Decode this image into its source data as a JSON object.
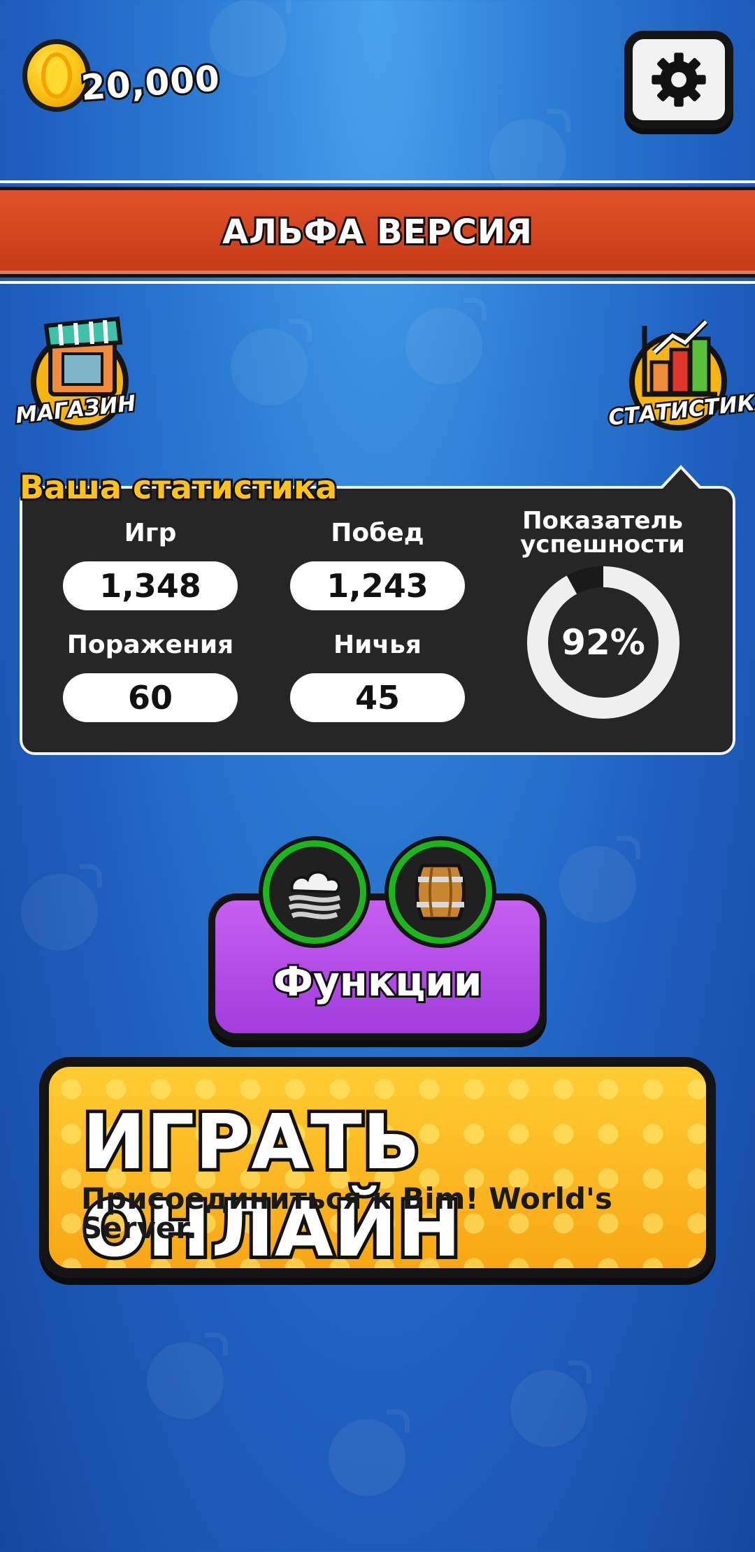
{
  "header": {
    "coins": "20,000",
    "settings_icon": "gear-icon"
  },
  "banner": {
    "text": "АЛЬФА ВЕРСИЯ",
    "color": "#d54521"
  },
  "side_buttons": {
    "shop_label": "МАГАЗИН",
    "stats_label": "СТАТИСТИКА"
  },
  "stats": {
    "title": "Ваша статистика",
    "games_label": "Игр",
    "games_value": "1,348",
    "wins_label": "Побед",
    "wins_value": "1,243",
    "losses_label": "Поражения",
    "losses_value": "60",
    "draws_label": "Ничья",
    "draws_value": "45",
    "success_label": "Показатель успешности",
    "success_value": "92%",
    "success_fraction": 0.92
  },
  "functions": {
    "label": "Функции",
    "color": "#b34be6",
    "icons": [
      "cloud-icon",
      "barrel-icon"
    ]
  },
  "play": {
    "title": "ИГРАТЬ ОНЛАЙН",
    "subtitle": "Присоединиться к Bim! World's Server.",
    "color": "#fbb622"
  }
}
